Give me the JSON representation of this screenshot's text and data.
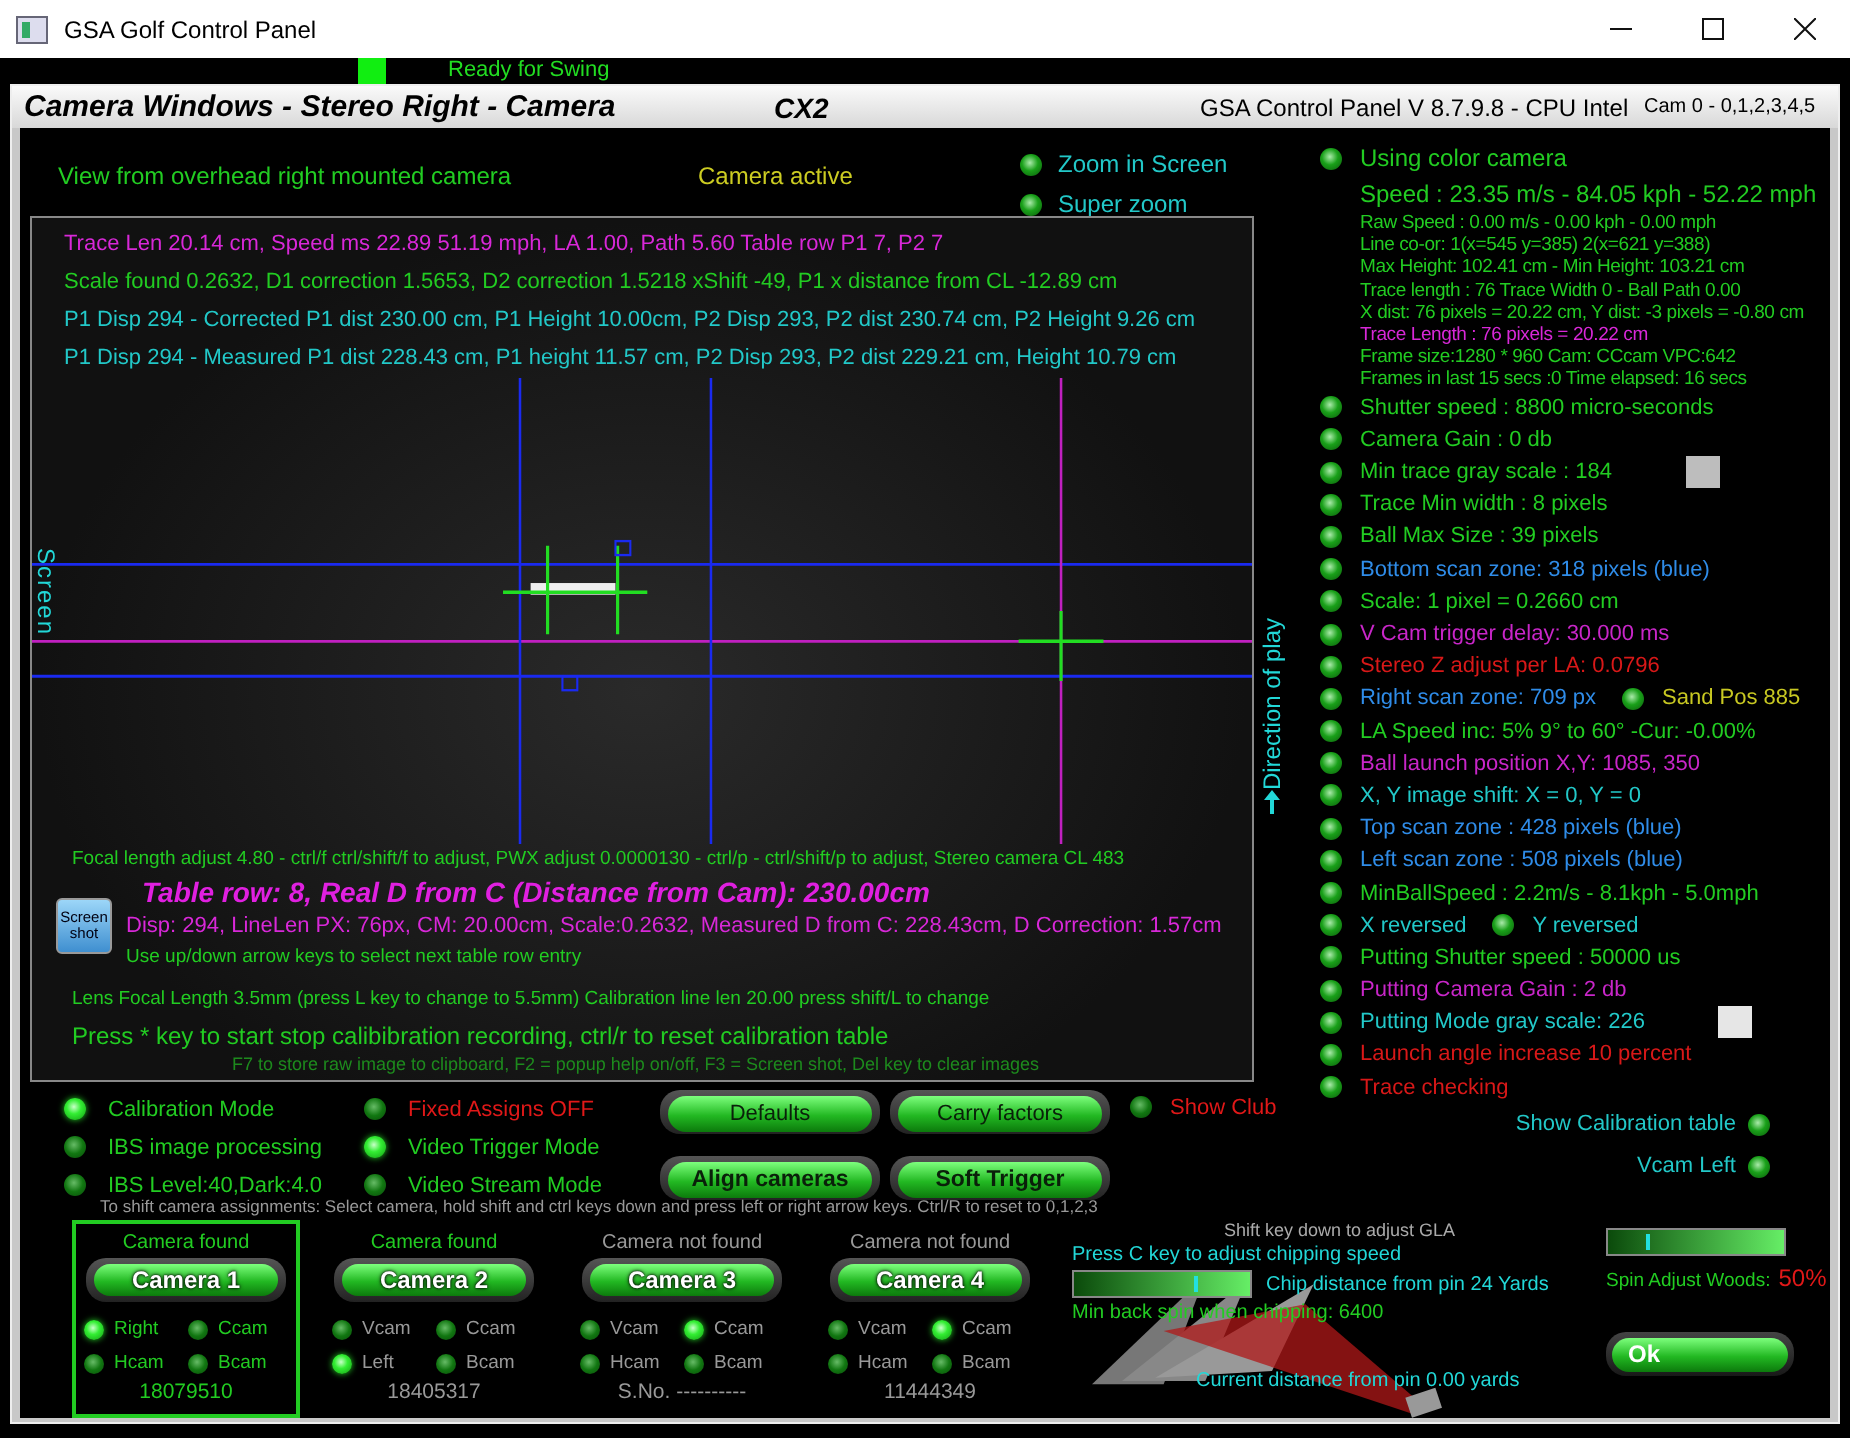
{
  "window": {
    "title": "GSA Golf Control Panel"
  },
  "status": {
    "text": "Ready for Swing",
    "ready": true
  },
  "panel": {
    "title": "Camera Windows - Stereo Right - Camera",
    "camera_code": "CX2",
    "version": "GSA Control Panel V 8.7.9.8 - CPU Intel",
    "cam_list": "Cam 0 - 0,1,2,3,4,5"
  },
  "view": {
    "caption": "View from overhead right mounted camera",
    "state": "Camera active",
    "zoom_options": [
      "Zoom in Screen",
      "Super zoom"
    ],
    "side_label": "Screen",
    "direction_label": "Direction of play",
    "top_lines": [
      {
        "text": "Trace Len 20.14 cm, Speed ms 22.89 51.19 mph, LA 1.00, Path 5.60 Table row P1 7, P2 7",
        "color": "#d828d8"
      },
      {
        "text": "Scale found 0.2632, D1 correction 1.5653, D2 correction 1.5218 xShift -49, P1 x distance from CL -12.89 cm",
        "color": "#22cc22"
      },
      {
        "text": "P1 Disp 294 - Corrected P1 dist 230.00 cm, P1 Height 10.00cm, P2 Disp 293, P2 dist 230.74 cm, P2 Height 9.26 cm",
        "color": "#22c8c8"
      },
      {
        "text": "P1 Disp 294 - Measured P1 dist 228.43 cm, P1 height 11.57 cm, P2 Disp 293, P2 dist 229.21 cm, Height 10.79 cm",
        "color": "#22c8c8"
      }
    ],
    "focal_line": "Focal length adjust 4.80 - ctrl/f ctrl/shift/f to adjust, PWX adjust 0.0000130 - ctrl/p - ctrl/shift/p to adjust, Stereo camera CL 483",
    "table_row": "Table row: 8, Real D from C (Distance from Cam): 230.00cm",
    "screenshot_button": "Screen shot",
    "disp_line": "Disp: 294, LineLen PX: 76px, CM: 20.00cm, Scale:0.2632, Measured D from C: 228.43cm, D Correction: 1.57cm",
    "arrow_hint": "Use up/down arrow keys to select next table row entry",
    "lens_line": "Lens Focal Length 3.5mm (press L key to change to 5.5mm) Calibration line len 20.00 press shift/L to change",
    "record_hint": "Press * key to start stop calibibration recording, ctrl/r to reset calibration table",
    "key_hint": "F7 to store raw image to clipboard, F2 = popup help on/off, F3 = Screen shot, Del key to clear images"
  },
  "options": [
    {
      "label": "Calibration Mode",
      "on": true,
      "color": "#22cc22"
    },
    {
      "label": "IBS image processing",
      "on": false,
      "color": "#22cc22"
    },
    {
      "label": "IBS Level:40,Dark:4.0",
      "on": false,
      "color": "#22cc22"
    },
    {
      "label": "Fixed Assigns OFF",
      "on": false,
      "color": "#e01818"
    },
    {
      "label": "Video Trigger Mode",
      "on": true,
      "color": "#22cc22"
    },
    {
      "label": "Video Stream Mode",
      "on": false,
      "color": "#22cc22"
    }
  ],
  "buttons": [
    {
      "label": "Defaults",
      "kind": "plain"
    },
    {
      "label": "Carry factors",
      "kind": "plain"
    },
    {
      "label": "Align cameras",
      "kind": "bold"
    },
    {
      "label": "Soft Trigger",
      "kind": "bold"
    }
  ],
  "show_club": {
    "label": "Show Club",
    "on": false
  },
  "assign_hint": "To shift camera assignments: Select camera, hold shift and ctrl keys down and press left or right arrow keys. Ctrl/R to reset to 0,1,2,3",
  "cameras": [
    {
      "status": "Camera found",
      "found": true,
      "button": "Camera 1",
      "selected": true,
      "leds": [
        {
          "label": "Right",
          "on": true
        },
        {
          "label": "Ccam",
          "on": false
        },
        {
          "label": "Hcam",
          "on": false
        },
        {
          "label": "Bcam",
          "on": false
        }
      ],
      "serial": "18079510"
    },
    {
      "status": "Camera found",
      "found": true,
      "button": "Camera 2",
      "selected": false,
      "leds": [
        {
          "label": "Vcam",
          "on": false
        },
        {
          "label": "Ccam",
          "on": false
        },
        {
          "label": "Left",
          "on": true
        },
        {
          "label": "Bcam",
          "on": false
        }
      ],
      "serial": "18405317"
    },
    {
      "status": "Camera not found",
      "found": false,
      "button": "Camera 3",
      "selected": false,
      "leds": [
        {
          "label": "Vcam",
          "on": false
        },
        {
          "label": "Ccam",
          "on": true
        },
        {
          "label": "Hcam",
          "on": false
        },
        {
          "label": "Bcam",
          "on": false
        }
      ],
      "serial": "S.No. ----------"
    },
    {
      "status": "Camera not found",
      "found": false,
      "button": "Camera 4",
      "selected": false,
      "leds": [
        {
          "label": "Vcam",
          "on": false
        },
        {
          "label": "Ccam",
          "on": true
        },
        {
          "label": "Hcam",
          "on": false
        },
        {
          "label": "Bcam",
          "on": false
        }
      ],
      "serial": "11444349"
    }
  ],
  "right": {
    "status_lines": [
      {
        "text": "Using color camera",
        "kind": "led",
        "color": "#22cc22"
      },
      {
        "text": "Speed : 23.35 m/s - 84.05 kph - 52.22 mph",
        "kind": "large",
        "color": "#22cc22"
      },
      {
        "text": "Raw Speed : 0.00 m/s - 0.00 kph - 0.00 mph",
        "kind": "small",
        "color": "#22cc22"
      },
      {
        "text": "Line co-or: 1(x=545 y=385) 2(x=621 y=388)",
        "kind": "small",
        "color": "#22cc22"
      },
      {
        "text": "Max Height: 102.41 cm - Min Height: 103.21 cm",
        "kind": "small",
        "color": "#22cc22"
      },
      {
        "text": "Trace length : 76 Trace Width 0 - Ball Path 0.00",
        "kind": "small",
        "color": "#22cc22"
      },
      {
        "text": "X dist: 76 pixels = 20.22 cm, Y dist: -3 pixels = -0.80 cm",
        "kind": "small",
        "color": "#22cc22"
      },
      {
        "text": "Trace Length : 76 pixels = 20.22 cm",
        "kind": "small",
        "color": "#d828d8"
      },
      {
        "text": "Frame size:1280 * 960 Cam: CCcam VPC:642",
        "kind": "small",
        "color": "#22cc22"
      },
      {
        "text": "Frames in last 15 secs :0 Time elapsed:  16 secs",
        "kind": "small",
        "color": "#22cc22"
      }
    ],
    "settings": [
      {
        "label": "Shutter speed : 8800 micro-seconds",
        "color": "#22cc22"
      },
      {
        "label": "Camera Gain : 0 db",
        "color": "#22cc22"
      },
      {
        "label": "Min trace gray scale : 184",
        "color": "#22cc22",
        "swatch": {
          "color": "#bdbdbd"
        }
      },
      {
        "label": "Trace Min width : 8 pixels",
        "color": "#22cc22"
      },
      {
        "label": "Ball Max Size : 39 pixels",
        "color": "#22cc22"
      },
      {
        "label": "Bottom scan zone: 318 pixels (blue)",
        "color": "#2f8ce8"
      },
      {
        "label": "Scale: 1 pixel = 0.2660 cm",
        "color": "#22cc22"
      },
      {
        "label": "V Cam trigger delay: 30.000 ms",
        "color": "#c826c8"
      },
      {
        "label": "Stereo Z adjust per LA: 0.0796",
        "color": "#d81818"
      },
      {
        "label": "Right scan zone: 709 px",
        "color": "#2f8ce8",
        "extra": {
          "label": "Sand Pos 885",
          "color": "#c8c822"
        }
      },
      {
        "label": "LA Speed inc: 5% 9° to 60° -Cur: -0.00%",
        "color": "#22cc22"
      },
      {
        "label": "Ball launch position X,Y: 1085, 350",
        "color": "#c826c8"
      },
      {
        "label": "X, Y image shift: X = 0, Y = 0",
        "color": "#22c8c8"
      },
      {
        "label": "Top scan zone : 428 pixels (blue)",
        "color": "#2f8ce8"
      },
      {
        "label": "Left scan zone : 508 pixels (blue)",
        "color": "#2f8ce8"
      },
      {
        "label": "MinBallSpeed : 2.2m/s - 8.1kph - 5.0mph",
        "color": "#22cc22"
      },
      {
        "label": "X reversed",
        "color": "#22c8c8",
        "extra": {
          "label": "Y reversed",
          "color": "#22c8c8"
        }
      },
      {
        "label": "Putting Shutter speed : 50000 us",
        "color": "#22cc22"
      },
      {
        "label": "Putting Camera Gain : 2 db",
        "color": "#c826c8"
      },
      {
        "label": "Putting Mode gray scale: 226",
        "color": "#22c8c8",
        "swatch": {
          "color": "#e6e6e6"
        }
      },
      {
        "label": "Launch angle increase 10 percent",
        "color": "#d81818"
      },
      {
        "label": "Trace checking",
        "color": "#d81818"
      }
    ],
    "toggles": [
      "Show Calibration table",
      "Vcam Left"
    ]
  },
  "chipping": {
    "hint": "Shift key down to adjust GLA",
    "speed_label": "Press C key to adjust chipping speed",
    "level": 0.68,
    "distance": "Chip distance from pin 24 Yards",
    "backspin": "Min back spin when chipping: 6400",
    "current": "Current distance from pin 0.00 yards"
  },
  "spin": {
    "level": 0.22,
    "label": "Spin Adjust Woods:",
    "value": "50%"
  },
  "ok_button": "Ok"
}
